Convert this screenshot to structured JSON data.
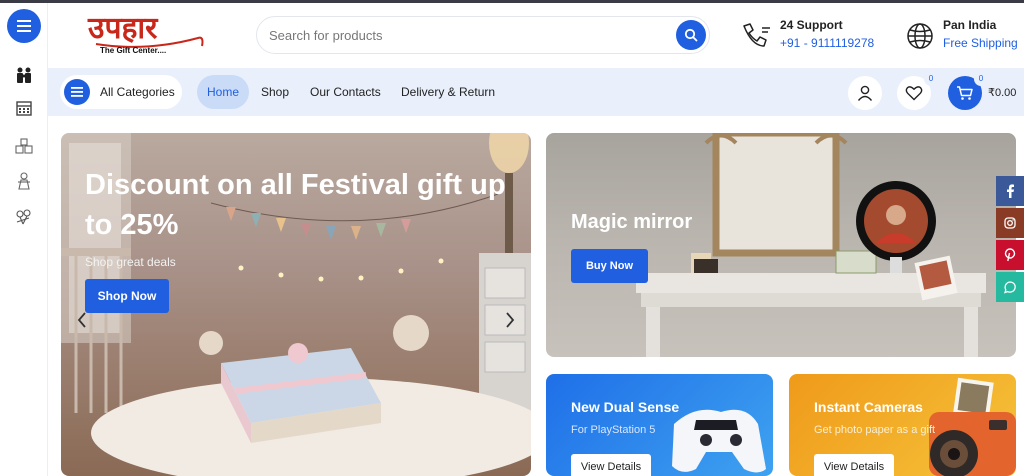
{
  "logo": {
    "main": "उपहार",
    "sub": "The Gift Center....",
    "color": "#c8271a"
  },
  "search": {
    "placeholder": "Search for products"
  },
  "support": {
    "title": "24 Support",
    "phone": "+91 - 9111119278"
  },
  "shipping": {
    "title": "Pan India",
    "text": "Free Shipping"
  },
  "nav": {
    "all_categories": "All Categories",
    "items": [
      {
        "label": "Home",
        "active": true
      },
      {
        "label": "Shop"
      },
      {
        "label": "Our Contacts"
      },
      {
        "label": "Delivery & Return"
      }
    ],
    "wishlist_count": "0",
    "cart_count": "0",
    "cart_total": "₹0.00"
  },
  "banners": {
    "main": {
      "title": "Discount on all Festival gift up to 25%",
      "subtitle": "Shop great deals",
      "button": "Shop Now"
    },
    "mirror": {
      "title": "Magic mirror",
      "button": "Buy Now"
    },
    "dual": {
      "title": "New Dual Sense",
      "subtitle": "For PlayStation 5",
      "button": "View Details"
    },
    "camera": {
      "title": "Instant Cameras",
      "subtitle": "Get photo paper as a gift",
      "button": "View Details"
    }
  },
  "colors": {
    "brand": "#1f5fe0",
    "facebook": "#3b5998",
    "instagram": "#8a3b26",
    "pinterest": "#c8102e",
    "whatsapp": "#25b9a0"
  },
  "social": [
    "facebook-icon",
    "instagram-icon",
    "pinterest-icon",
    "whatsapp-icon"
  ]
}
